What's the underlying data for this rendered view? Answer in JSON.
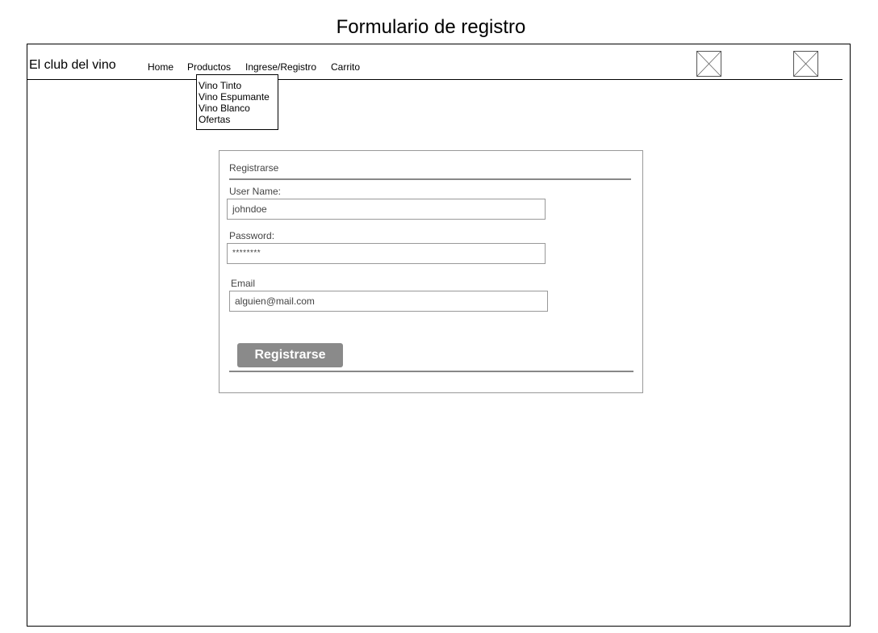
{
  "page": {
    "title": "Formulario de registro"
  },
  "header": {
    "brand": "El club del vino",
    "nav": {
      "home": "Home",
      "productos": "Productos",
      "ingrese": "Ingrese/Registro",
      "carrito": "Carrito"
    },
    "icons": [
      "image-placeholder-icon",
      "image-placeholder-icon"
    ]
  },
  "dropdown": {
    "items": [
      "Vino Tinto",
      "Vino Espumante",
      "Vino Blanco",
      "Ofertas"
    ]
  },
  "form": {
    "heading": "Registrarse",
    "username": {
      "label": "User Name:",
      "value": "johndoe"
    },
    "password": {
      "label": "Password:",
      "value": "********"
    },
    "email": {
      "label": "Email",
      "value": "alguien@mail.com"
    },
    "submit_label": "Registrarse"
  },
  "colors": {
    "button_bg": "#8a8a8a",
    "rule": "#888888",
    "frame_border": "#000000"
  }
}
